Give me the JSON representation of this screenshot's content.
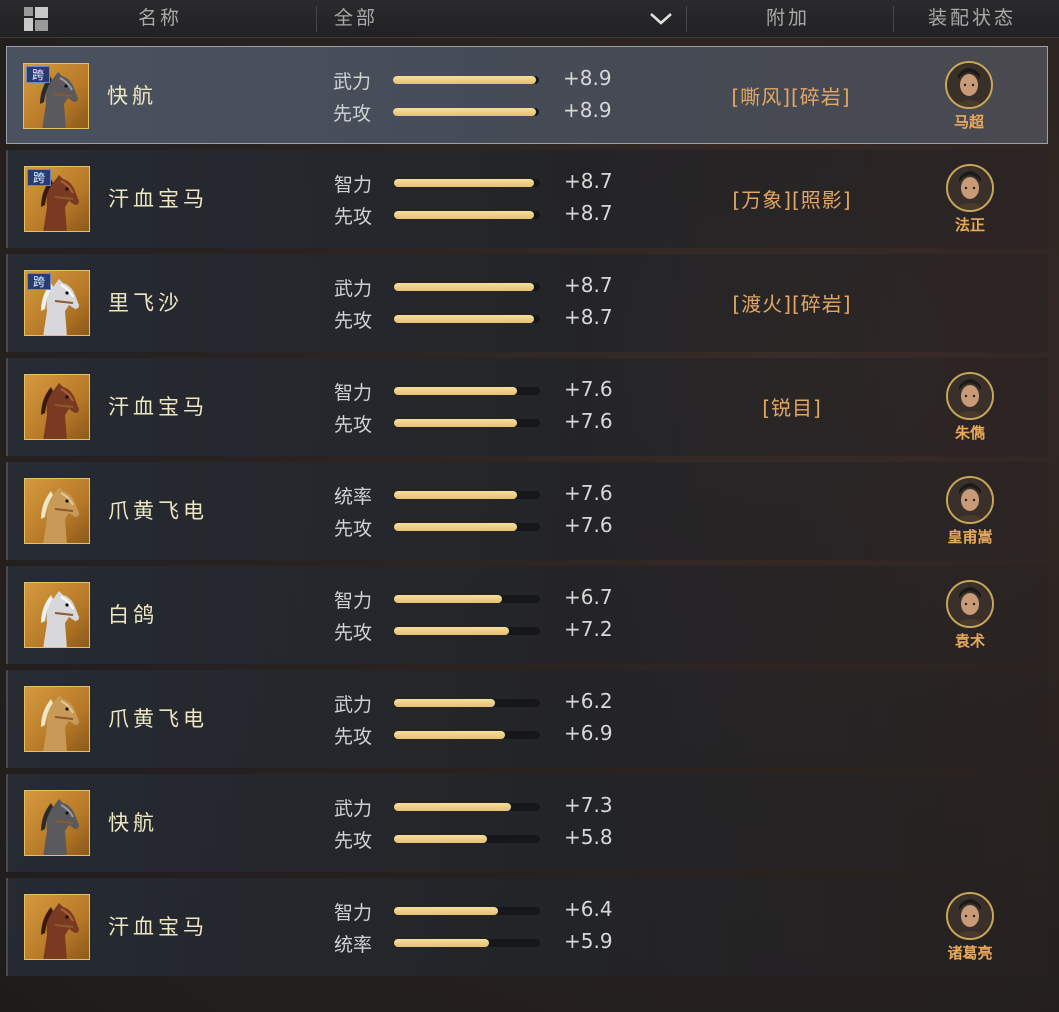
{
  "header": {
    "name_label": "名称",
    "filter_label": "全部",
    "attach_label": "附加",
    "equip_label": "装配状态"
  },
  "rows": [
    {
      "name": "快航",
      "cross": "跨",
      "horse": "grey",
      "selected": true,
      "stats": [
        {
          "label": "武力",
          "value": "+8.9",
          "fill": 0.98
        },
        {
          "label": "先攻",
          "value": "+8.9",
          "fill": 0.98
        }
      ],
      "attach": "[嘶风][碎岩]",
      "general": "马超"
    },
    {
      "name": "汗血宝马",
      "cross": "跨",
      "horse": "red",
      "selected": false,
      "stats": [
        {
          "label": "智力",
          "value": "+8.7",
          "fill": 0.96
        },
        {
          "label": "先攻",
          "value": "+8.7",
          "fill": 0.96
        }
      ],
      "attach": "[万象][照影]",
      "general": "法正"
    },
    {
      "name": "里飞沙",
      "cross": "跨",
      "horse": "white",
      "selected": false,
      "stats": [
        {
          "label": "武力",
          "value": "+8.7",
          "fill": 0.96
        },
        {
          "label": "先攻",
          "value": "+8.7",
          "fill": 0.96
        }
      ],
      "attach": "[渡火][碎岩]",
      "general": ""
    },
    {
      "name": "汗血宝马",
      "cross": "",
      "horse": "red",
      "selected": false,
      "stats": [
        {
          "label": "智力",
          "value": "+7.6",
          "fill": 0.84
        },
        {
          "label": "先攻",
          "value": "+7.6",
          "fill": 0.84
        }
      ],
      "attach": "[锐目]",
      "general": "朱儁"
    },
    {
      "name": "爪黄飞电",
      "cross": "",
      "horse": "gold",
      "selected": false,
      "stats": [
        {
          "label": "统率",
          "value": "+7.6",
          "fill": 0.84
        },
        {
          "label": "先攻",
          "value": "+7.6",
          "fill": 0.84
        }
      ],
      "attach": "",
      "general": "皇甫嵩"
    },
    {
      "name": "白鸽",
      "cross": "",
      "horse": "white",
      "selected": false,
      "stats": [
        {
          "label": "智力",
          "value": "+6.7",
          "fill": 0.74
        },
        {
          "label": "先攻",
          "value": "+7.2",
          "fill": 0.79
        }
      ],
      "attach": "",
      "general": "袁术"
    },
    {
      "name": "爪黄飞电",
      "cross": "",
      "horse": "gold",
      "selected": false,
      "stats": [
        {
          "label": "武力",
          "value": "+6.2",
          "fill": 0.69
        },
        {
          "label": "先攻",
          "value": "+6.9",
          "fill": 0.76
        }
      ],
      "attach": "",
      "general": ""
    },
    {
      "name": "快航",
      "cross": "",
      "horse": "grey",
      "selected": false,
      "stats": [
        {
          "label": "武力",
          "value": "+7.3",
          "fill": 0.8
        },
        {
          "label": "先攻",
          "value": "+5.8",
          "fill": 0.64
        }
      ],
      "attach": "",
      "general": ""
    },
    {
      "name": "汗血宝马",
      "cross": "",
      "horse": "red",
      "selected": false,
      "stats": [
        {
          "label": "智力",
          "value": "+6.4",
          "fill": 0.71
        },
        {
          "label": "统率",
          "value": "+5.9",
          "fill": 0.65
        }
      ],
      "attach": "",
      "general": "诸葛亮"
    }
  ]
}
